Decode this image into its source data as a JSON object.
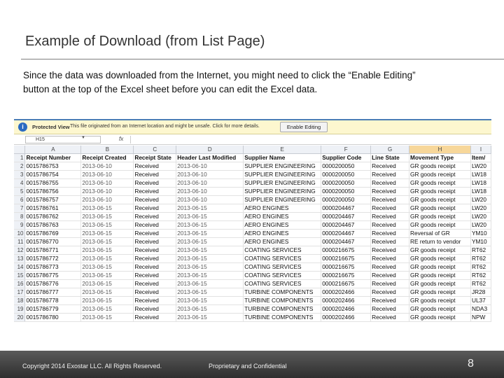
{
  "slide": {
    "title": "Example of Download (from List Page)",
    "body_line1": "Since the data was downloaded from the Internet, you might need to click the “Enable Editing”",
    "body_line2": "button at the top of the Excel sheet before you can edit the Excel data."
  },
  "excel": {
    "protected_view_label": "Protected View",
    "protected_view_message": "This file originated from an Internet location and might be unsafe. Click for more details.",
    "enable_editing_label": "Enable Editing",
    "name_box": "H15",
    "fx_label": "fx",
    "column_letters": [
      "A",
      "B",
      "C",
      "D",
      "E",
      "F",
      "G",
      "H",
      "I"
    ],
    "headers": [
      "Receipt Number",
      "Receipt Created",
      "Receipt State",
      "Header Last Modified",
      "Supplier Name",
      "Supplier Code",
      "Line State",
      "Movement Type",
      "Item/"
    ],
    "rows": [
      [
        "0015786753",
        "2013-06-10",
        "Received",
        "2013-06-10",
        "SUPPLIER ENGINEERING",
        "0000200050",
        "Received",
        "GR goods receipt",
        "LW20"
      ],
      [
        "0015786754",
        "2013-06-10",
        "Received",
        "2013-06-10",
        "SUPPLIER ENGINEERING",
        "0000200050",
        "Received",
        "GR goods receipt",
        "LW18"
      ],
      [
        "0015786755",
        "2013-06-10",
        "Received",
        "2013-06-10",
        "SUPPLIER ENGINEERING",
        "0000200050",
        "Received",
        "GR goods receipt",
        "LW18"
      ],
      [
        "0015786756",
        "2013-06-10",
        "Received",
        "2013-06-10",
        "SUPPLIER ENGINEERING",
        "0000200050",
        "Received",
        "GR goods receipt",
        "LW18"
      ],
      [
        "0015786757",
        "2013-06-10",
        "Received",
        "2013-06-10",
        "SUPPLIER ENGINEERING",
        "0000200050",
        "Received",
        "GR goods receipt",
        "LW20"
      ],
      [
        "0015786761",
        "2013-06-15",
        "Received",
        "2013-06-15",
        "AERO ENGINES",
        "0000204467",
        "Received",
        "GR goods receipt",
        "LW20"
      ],
      [
        "0015786762",
        "2013-06-15",
        "Received",
        "2013-06-15",
        "AERO ENGINES",
        "0000204467",
        "Received",
        "GR goods receipt",
        "LW20"
      ],
      [
        "0015786763",
        "2013-06-15",
        "Received",
        "2013-06-15",
        "AERO ENGINES",
        "0000204467",
        "Received",
        "GR goods receipt",
        "LW20"
      ],
      [
        "0015786769",
        "2013-06-15",
        "Received",
        "2013-06-15",
        "AERO ENGINES",
        "0000204467",
        "Received",
        "Reversal of GR",
        "YM10"
      ],
      [
        "0015786770",
        "2013-06-15",
        "Received",
        "2013-06-15",
        "AERO ENGINES",
        "0000204467",
        "Received",
        "RE return to vendor",
        "YM10"
      ],
      [
        "0015786771",
        "2013-06-15",
        "Received",
        "2013-06-15",
        "COATING SERVICES",
        "0000216675",
        "Received",
        "GR goods receipt",
        "RT62"
      ],
      [
        "0015786772",
        "2013-06-15",
        "Received",
        "2013-06-15",
        "COATING SERVICES",
        "0000216675",
        "Received",
        "GR goods receipt",
        "RT62"
      ],
      [
        "0015786773",
        "2013-06-15",
        "Received",
        "2013-06-15",
        "COATING SERVICES",
        "0000216675",
        "Received",
        "GR goods receipt",
        "RT62"
      ],
      [
        "0015786775",
        "2013-06-15",
        "Received",
        "2013-06-15",
        "COATING SERVICES",
        "0000216675",
        "Received",
        "GR goods receipt",
        "RT62"
      ],
      [
        "0015786776",
        "2013-06-15",
        "Received",
        "2013-06-15",
        "COATING SERVICES",
        "0000216675",
        "Received",
        "GR goods receipt",
        "RT62"
      ],
      [
        "0015786777",
        "2013-06-15",
        "Received",
        "2013-06-15",
        "TURBINE COMPONENTS",
        "0000202466",
        "Received",
        "GR goods receipt",
        "JR28"
      ],
      [
        "0015786778",
        "2013-06-15",
        "Received",
        "2013-06-15",
        "TURBINE COMPONENTS",
        "0000202466",
        "Received",
        "GR goods receipt",
        "UL37"
      ],
      [
        "0015786779",
        "2013-06-15",
        "Received",
        "2013-06-15",
        "TURBINE COMPONENTS",
        "0000202466",
        "Received",
        "GR goods receipt",
        "NDA3"
      ],
      [
        "0015786780",
        "2013-06-15",
        "Received",
        "2013-06-15",
        "TURBINE COMPONENTS",
        "0000202466",
        "Received",
        "GR goods receipt",
        "NPW"
      ]
    ]
  },
  "footer": {
    "copyright": "Copyright 2014 Exostar LLC. All Rights Reserved.",
    "proprietary": "Proprietary and Confidential",
    "page_number": "8"
  }
}
